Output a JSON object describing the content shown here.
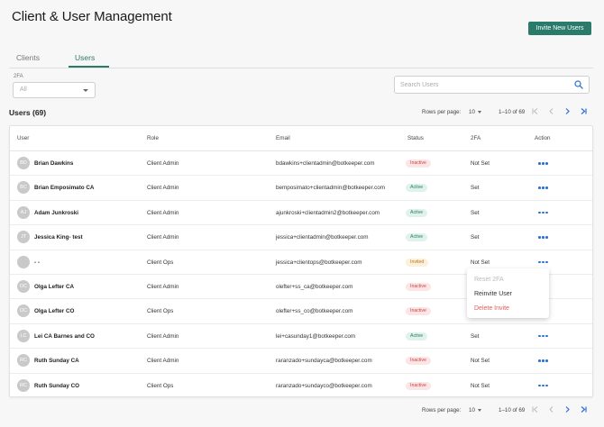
{
  "page": {
    "title": "Client & User Management",
    "invite_button": "Invite New Users"
  },
  "tabs": [
    {
      "label": "Clients"
    },
    {
      "label": "Users"
    }
  ],
  "filter": {
    "label": "2FA",
    "value": "All"
  },
  "search": {
    "placeholder": "Search Users"
  },
  "users_heading": "Users (69)",
  "pagination": {
    "label": "Rows per page:",
    "rows_per_page": "10",
    "range": "1–10 of 69"
  },
  "table": {
    "headers": [
      "User",
      "Role",
      "Email",
      "Status",
      "2FA",
      "Action"
    ],
    "rows": [
      {
        "initials": "BD",
        "name": "Brian Dawkins",
        "role": "Client Admin",
        "email": "bdawkins+clientadmin@botkeeper.com",
        "status": "Inactive",
        "twofa": "Not Set"
      },
      {
        "initials": "BC",
        "name": "Brian Emposimato CA",
        "role": "Client Admin",
        "email": "bemposimato+clientadmin@botkeeper.com",
        "status": "Active",
        "twofa": "Set"
      },
      {
        "initials": "AJ",
        "name": "Adam Junkroski",
        "role": "Client Admin",
        "email": "ajunkroski+clientadmin2@botkeeper.com",
        "status": "Active",
        "twofa": "Set"
      },
      {
        "initials": "JT",
        "name": "Jessica King- test",
        "role": "Client Admin",
        "email": "jessica+clientadmin@botkeeper.com",
        "status": "Active",
        "twofa": "Set"
      },
      {
        "initials": "",
        "name": "- -",
        "role": "Client Ops",
        "email": "jessica+clientops@botkeeper.com",
        "status": "Invited",
        "twofa": "Not Set"
      },
      {
        "initials": "OC",
        "name": "Olga Lefter CA",
        "role": "Client Admin",
        "email": "olefter+ss_ca@botkeeper.com",
        "status": "Inactive",
        "twofa": ""
      },
      {
        "initials": "OC",
        "name": "Olga Lefter CO",
        "role": "Client Ops",
        "email": "olefter+ss_co@botkeeper.com",
        "status": "Inactive",
        "twofa": ""
      },
      {
        "initials": "LC",
        "name": "Lei CA Barnes and CO",
        "role": "Client Admin",
        "email": "lei+casunday1@botkeeper.com",
        "status": "Active",
        "twofa": "Set"
      },
      {
        "initials": "RC",
        "name": "Ruth Sunday CA",
        "role": "Client Admin",
        "email": "raranzado+sundayca@botkeeper.com",
        "status": "Inactive",
        "twofa": "Not Set"
      },
      {
        "initials": "RC",
        "name": "Ruth Sunday CO",
        "role": "Client Ops",
        "email": "raranzado+sundayco@botkeeper.com",
        "status": "Inactive",
        "twofa": "Not Set"
      }
    ]
  },
  "action_menu": {
    "items": [
      "Reset 2FA",
      "Reinvite User",
      "Delete Invite"
    ]
  },
  "colors": {
    "accent": "#2a7b6b",
    "action_dots": "#2d6fd6",
    "danger": "#e05b5b"
  }
}
